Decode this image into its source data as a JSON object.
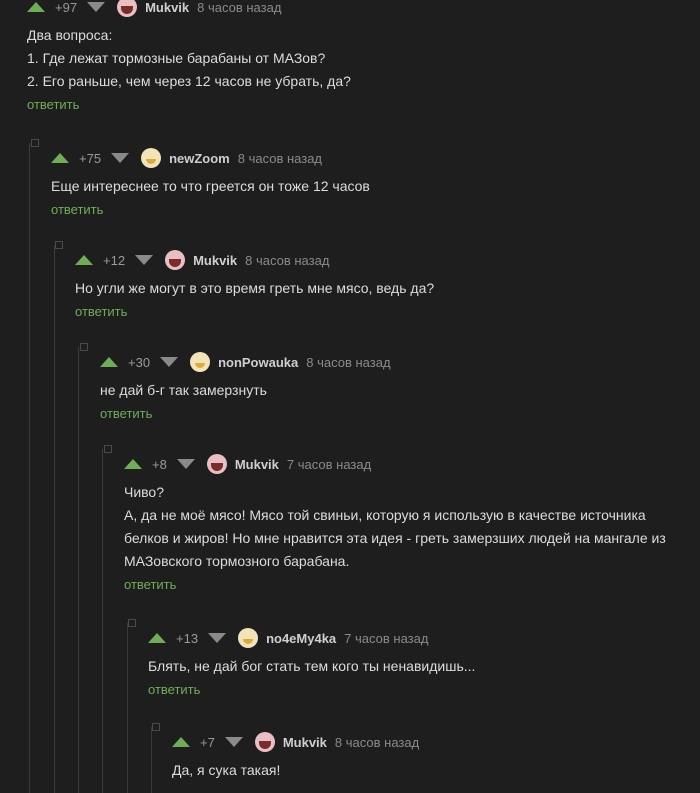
{
  "comments": [
    {
      "score": "+97",
      "user": "Mukvik",
      "avatar": "mukvik-avatar",
      "time": "8 часов назад",
      "lines": [
        "Два вопроса:",
        "1. Где лежат тормозные барабаны от МАЗов?",
        "2. Его раньше, чем через 12 часов не убрать, да?"
      ],
      "reply": "ответить"
    },
    {
      "score": "+75",
      "user": "newZoom",
      "avatar": "yellow-avatar",
      "time": "8 часов назад",
      "lines": [
        "Еще интереснее то что греется он тоже 12 часов"
      ],
      "reply": "ответить"
    },
    {
      "score": "+12",
      "user": "Mukvik",
      "avatar": "mukvik-avatar",
      "time": "8 часов назад",
      "lines": [
        "Но угли же могут в это время греть мне мясо, ведь да?"
      ],
      "reply": "ответить"
    },
    {
      "score": "+30",
      "user": "nonPowauka",
      "avatar": "yellow-avatar",
      "time": "8 часов назад",
      "lines": [
        "не дай б-г так замерзнуть"
      ],
      "reply": "ответить"
    },
    {
      "score": "+8",
      "user": "Mukvik",
      "avatar": "mukvik-avatar",
      "time": "7 часов назад",
      "lines": [
        "Чиво?",
        "А, да не моё мясо! Мясо той свиньи, которую я использую в качестве источника",
        "белков и жиров! Но мне нравится эта идея - греть замерзших людей на мангале из",
        "МАЗовского тормозного барабана."
      ],
      "reply": "ответить"
    },
    {
      "score": "+13",
      "user": "no4eMy4ka",
      "avatar": "yellow-avatar",
      "time": "7 часов назад",
      "lines": [
        "Блять, не дай бог стать тем кого ты ненавидишь..."
      ],
      "reply": "ответить"
    },
    {
      "score": "+7",
      "user": "Mukvik",
      "avatar": "mukvik-avatar",
      "time": "8 часов назад",
      "lines": [
        "Да, я сука такая!"
      ],
      "reply": ""
    }
  ]
}
